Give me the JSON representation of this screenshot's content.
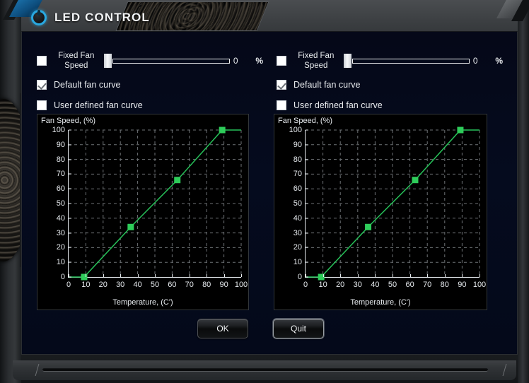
{
  "window": {
    "title": "LED CONTROL",
    "logo_icon": "knob-icon",
    "accent_color": "#29a8e0"
  },
  "panels": [
    {
      "id": "left",
      "fixed_fan_speed": {
        "label": "Fixed Fan\nSpeed",
        "label_line1": "Fixed Fan",
        "label_line2": "Speed",
        "checked": false,
        "slider_value": "0",
        "slider_min": 0,
        "slider_max": 100,
        "unit": "%"
      },
      "default_fan_curve": {
        "label": "Default fan curve",
        "checked": true
      },
      "user_defined_fan_curve": {
        "label": "User defined fan curve",
        "checked": false
      }
    },
    {
      "id": "right",
      "fixed_fan_speed": {
        "label": "Fixed Fan\nSpeed",
        "label_line1": "Fixed Fan",
        "label_line2": "Speed",
        "checked": false,
        "slider_value": "0",
        "slider_min": 0,
        "slider_max": 100,
        "unit": "%"
      },
      "default_fan_curve": {
        "label": "Default fan curve",
        "checked": true
      },
      "user_defined_fan_curve": {
        "label": "User defined fan curve",
        "checked": false
      }
    }
  ],
  "buttons": {
    "ok": "OK",
    "quit": "Quit"
  },
  "chart_data": [
    {
      "type": "line",
      "title": "",
      "ylabel": "Fan Speed, (%)",
      "xlabel": "Temperature, (C')",
      "xlim": [
        0,
        100
      ],
      "ylim": [
        0,
        100
      ],
      "xticks": [
        0,
        10,
        20,
        30,
        40,
        50,
        60,
        70,
        80,
        90,
        100
      ],
      "yticks": [
        0,
        10,
        20,
        30,
        40,
        50,
        60,
        70,
        80,
        90,
        100
      ],
      "grid": true,
      "legend": "none",
      "line_color": "#27c35a",
      "marker_color": "#2ecc5a",
      "marker": "square",
      "x": [
        0,
        9,
        36,
        63,
        89,
        100
      ],
      "y": [
        0,
        0,
        34,
        66,
        100,
        100
      ],
      "control_points": [
        {
          "x": 9,
          "y": 0
        },
        {
          "x": 36,
          "y": 34
        },
        {
          "x": 63,
          "y": 66
        },
        {
          "x": 89,
          "y": 100
        }
      ]
    },
    {
      "type": "line",
      "title": "",
      "ylabel": "Fan Speed, (%)",
      "xlabel": "Temperature, (C')",
      "xlim": [
        0,
        100
      ],
      "ylim": [
        0,
        100
      ],
      "xticks": [
        0,
        10,
        20,
        30,
        40,
        50,
        60,
        70,
        80,
        90,
        100
      ],
      "yticks": [
        0,
        10,
        20,
        30,
        40,
        50,
        60,
        70,
        80,
        90,
        100
      ],
      "grid": true,
      "legend": "none",
      "line_color": "#27c35a",
      "marker_color": "#2ecc5a",
      "marker": "square",
      "x": [
        0,
        9,
        36,
        63,
        89,
        100
      ],
      "y": [
        0,
        0,
        34,
        66,
        100,
        100
      ],
      "control_points": [
        {
          "x": 9,
          "y": 0
        },
        {
          "x": 36,
          "y": 34
        },
        {
          "x": 63,
          "y": 66
        },
        {
          "x": 89,
          "y": 100
        }
      ]
    }
  ]
}
